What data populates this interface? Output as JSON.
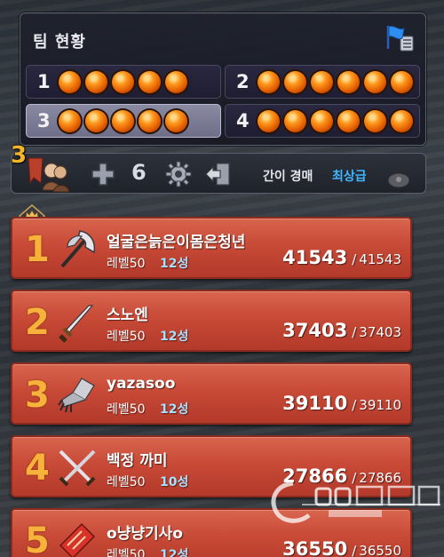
{
  "team_panel": {
    "title": "팀 현황",
    "flag_icon": "blue-flag-list-icon",
    "slots": [
      {
        "number": "1",
        "members": 5,
        "active": false
      },
      {
        "number": "2",
        "members": 6,
        "active": false
      },
      {
        "number": "3",
        "members": 5,
        "active": true
      },
      {
        "number": "4",
        "members": 6,
        "active": false
      }
    ],
    "dot_color": "#ff8a14"
  },
  "toolbar": {
    "team_number": "3",
    "party_icon": "party-members-icon",
    "plus_icon": "plus-icon",
    "count": "6",
    "gear_icon": "gear-icon",
    "exit_icon": "exit-icon",
    "auction_label": "간이 경매",
    "auction_grade": "최상급",
    "auction_grade_color": "#3fb6ff",
    "auction_icon": "loot-pouch-icon"
  },
  "members": [
    {
      "rank": "1",
      "name": "얼굴은늙은이몸은청년",
      "level": "레벨50",
      "tier": "12성",
      "hp_current": "41543",
      "hp_separator": "/",
      "hp_max": "41543",
      "weapon": "axe-icon",
      "leader": true
    },
    {
      "rank": "2",
      "name": "스노엔",
      "level": "레벨50",
      "tier": "12성",
      "hp_current": "37403",
      "hp_separator": "/",
      "hp_max": "37403",
      "weapon": "sword-icon",
      "leader": false
    },
    {
      "rank": "3",
      "name": "yazasoo",
      "level": "레벨50",
      "tier": "12성",
      "hp_current": "39110",
      "hp_separator": "/",
      "hp_max": "39110",
      "weapon": "gauntlet-icon",
      "leader": false
    },
    {
      "rank": "4",
      "name": "백정 까미",
      "level": "레벨50",
      "tier": "10성",
      "hp_current": "27866",
      "hp_separator": "/",
      "hp_max": "27866",
      "weapon": "crossed-blades-icon",
      "leader": false
    },
    {
      "rank": "5",
      "name": "o냥냥기사o",
      "level": "레벨50",
      "tier": "12성",
      "hp_current": "36550",
      "hp_separator": "/",
      "hp_max": "36550",
      "weapon": "talisman-icon",
      "leader": false
    }
  ],
  "colors": {
    "card_red": "#c84a37",
    "rank_gold": "#f6b23a",
    "tier_blue": "#a8e0ff"
  }
}
